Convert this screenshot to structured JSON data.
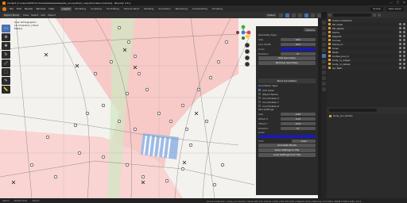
{
  "window": {
    "title": "model3 (C:\\Users\\DWF\\Archive\\datasets\\sites\\site_survey\\field_output\\model\\combined] - Blender 3.6.1",
    "controls": [
      "—",
      "□",
      "✕"
    ]
  },
  "menu": {
    "items": [
      "File",
      "Edit",
      "Render",
      "Window",
      "Help"
    ],
    "tabs": [
      {
        "label": "Layout",
        "active": true
      },
      {
        "label": "Modeling"
      },
      {
        "label": "Sculpting"
      },
      {
        "label": "UV Editing"
      },
      {
        "label": "Texture Paint"
      },
      {
        "label": "Shading"
      },
      {
        "label": "Animation"
      },
      {
        "label": "Rendering"
      },
      {
        "label": "Compositing"
      },
      {
        "label": "Scripting"
      }
    ],
    "scene_label": "Scene",
    "view_layer_label": "View Layer"
  },
  "header": {
    "mode": "Object Mode",
    "items": [
      "View",
      "Select",
      "Add",
      "Object"
    ],
    "orientation": "Global"
  },
  "viewport": {
    "overlay_lines": [
      "User Orthographic",
      "(1) Collection | Point",
      "Meters"
    ]
  },
  "side_panel": {
    "options_label": "Options",
    "geometry": {
      "title": "Geometry Type",
      "size_label": "Size",
      "size_value": "0.01",
      "line_width_label": "Line Width",
      "line_width_value": "0.01",
      "color_label": "Color",
      "rotation_label": "Rotation",
      "rotation_values": [
        "0°",
        "0°",
        "0°"
      ],
      "button_label": "Add Geometry",
      "button2_label": "Remove Geometry"
    },
    "point_annotation": {
      "title": "Point Annotation",
      "type_label": "Annotation Type",
      "checks": [
        {
          "label": "Add Index",
          "checked": true
        },
        {
          "label": "Object Name",
          "checked": false
        },
        {
          "label": "Coordinates X",
          "checked": false
        },
        {
          "label": "Coordinates Y",
          "checked": false
        },
        {
          "label": "Coordinates Z",
          "checked": false
        }
      ],
      "text_settings_label": "Text Settings",
      "size_label": "Size",
      "size_value": "0.50",
      "offset_x_label": "Offset X",
      "offset_x_value": "0.15",
      "offset_y_label": "Offset Y",
      "offset_y_value": "0.15",
      "rotation_label": "Rotation",
      "rotation_value": "0°",
      "font_label": "Font",
      "color_label": "Color",
      "load_label": "Load",
      "btn_annotate": "Annotate Points",
      "btn_save": "Save Settings to File",
      "btn_load": "Load Settings from File"
    }
  },
  "outliner": {
    "rows": [
      "Scene Collection",
      "PD mesh",
      "PD_labels",
      "Points",
      "Objects",
      "Curves",
      "Points_nr",
      "Lines",
      "Texts",
      "bodies_pos_nr",
      "body_nr_edges",
      "body_nr_labels",
      "Arc Path"
    ]
  },
  "properties": {
    "row_label": "body_arc_blocks"
  },
  "statusbar": {
    "left_items": [
      "Select",
      "Rotate View",
      "Object"
    ],
    "stats": "Scene Collection | body_arc.blocks | Verts 245,372 | Faces 1,031 | Tris 237,226 | Objects 0/21 | Memory 1.13 GiB | VRAM 0.5/8.0 GiB | 3.6.1"
  },
  "colors": {
    "pink_area": "#f7c9c7",
    "accent": "#4772b3",
    "annotation_blue": "#1a1ab4"
  }
}
